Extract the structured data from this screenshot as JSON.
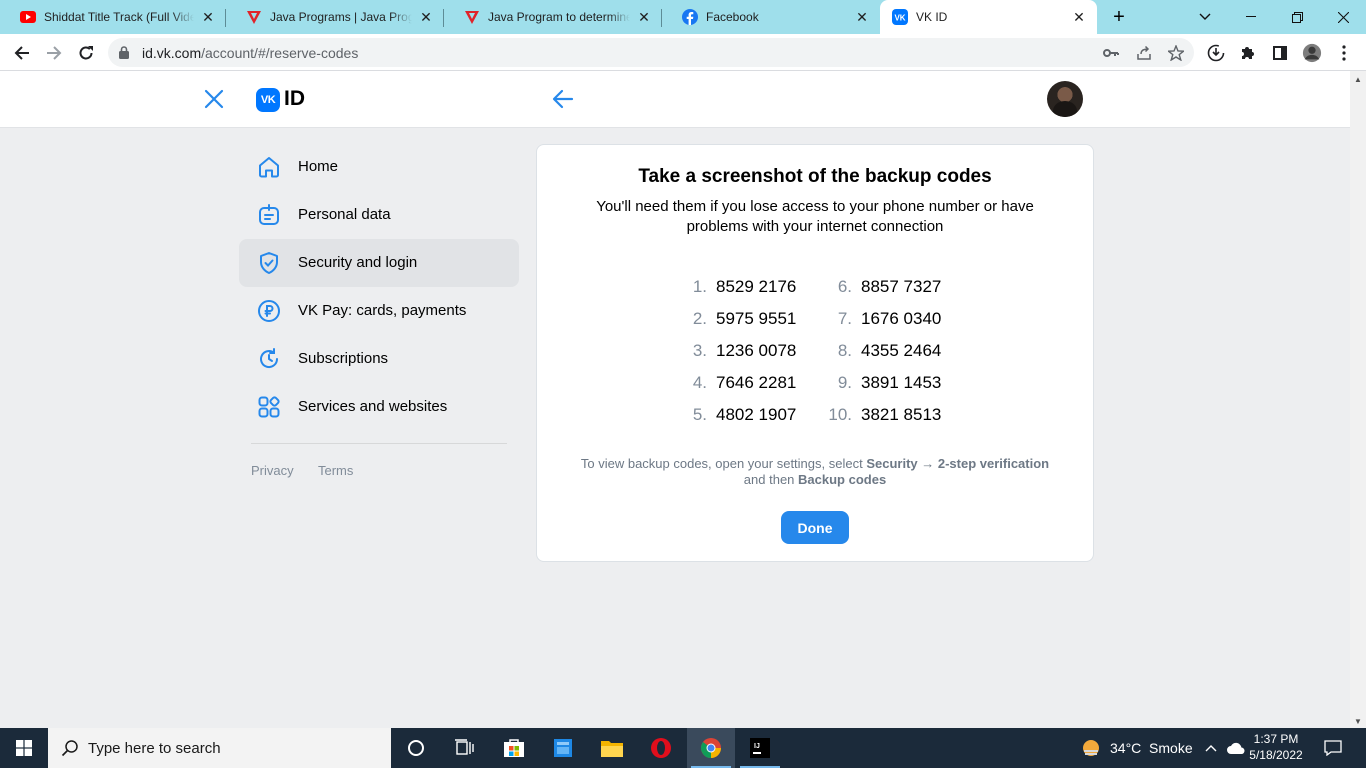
{
  "browser": {
    "tabs": [
      {
        "title": "Shiddat Title Track (Full Video",
        "favicon": "youtube-icon"
      },
      {
        "title": "Java Programs | Java Programs",
        "favicon": "javatpoint-icon"
      },
      {
        "title": "Java Program to determine wh",
        "favicon": "javatpoint-icon"
      },
      {
        "title": "Facebook",
        "favicon": "facebook-icon"
      },
      {
        "title": "VK ID",
        "favicon": "vk-icon"
      }
    ],
    "active_tab_index": 4,
    "new_tab_label": "+",
    "url_host": "id.vk.com",
    "url_path": "/account/#/reserve-codes"
  },
  "header": {
    "logo_text": "ID",
    "logo_mark": "VK"
  },
  "sidebar": {
    "items": [
      {
        "label": "Home",
        "icon": "home-icon"
      },
      {
        "label": "Personal data",
        "icon": "personal-data-icon"
      },
      {
        "label": "Security and login",
        "icon": "shield-icon",
        "active": true
      },
      {
        "label": "VK Pay: cards, payments",
        "icon": "ruble-icon"
      },
      {
        "label": "Subscriptions",
        "icon": "subscriptions-icon"
      },
      {
        "label": "Services and websites",
        "icon": "services-icon"
      }
    ],
    "footer": {
      "privacy": "Privacy",
      "terms": "Terms"
    }
  },
  "card": {
    "title": "Take a screenshot of the backup codes",
    "subtitle": "You'll need them if you lose access to your phone number or have problems with your internet connection",
    "codes": [
      {
        "n": "1.",
        "code": "8529 2176"
      },
      {
        "n": "2.",
        "code": "5975 9551"
      },
      {
        "n": "3.",
        "code": "1236 0078"
      },
      {
        "n": "4.",
        "code": "7646 2281"
      },
      {
        "n": "5.",
        "code": "4802 1907"
      },
      {
        "n": "6.",
        "code": "8857 7327"
      },
      {
        "n": "7.",
        "code": "1676 0340"
      },
      {
        "n": "8.",
        "code": "4355 2464"
      },
      {
        "n": "9.",
        "code": "3891 1453"
      },
      {
        "n": "10.",
        "code": "3821 8513"
      }
    ],
    "hint_prefix": "To view backup codes, open your settings, select",
    "hint_bold_1": "Security → 2-step verification",
    "hint_middle": "and then",
    "hint_bold_2": "Backup codes",
    "done_label": "Done"
  },
  "taskbar": {
    "search_placeholder": "Type here to search",
    "weather": "34°C  Smoke",
    "time": "1:37 PM",
    "date": "5/18/2022"
  },
  "colors": {
    "accent": "#2688eb",
    "vk_blue": "#0077ff",
    "tabstrip": "#9fdfeb"
  }
}
